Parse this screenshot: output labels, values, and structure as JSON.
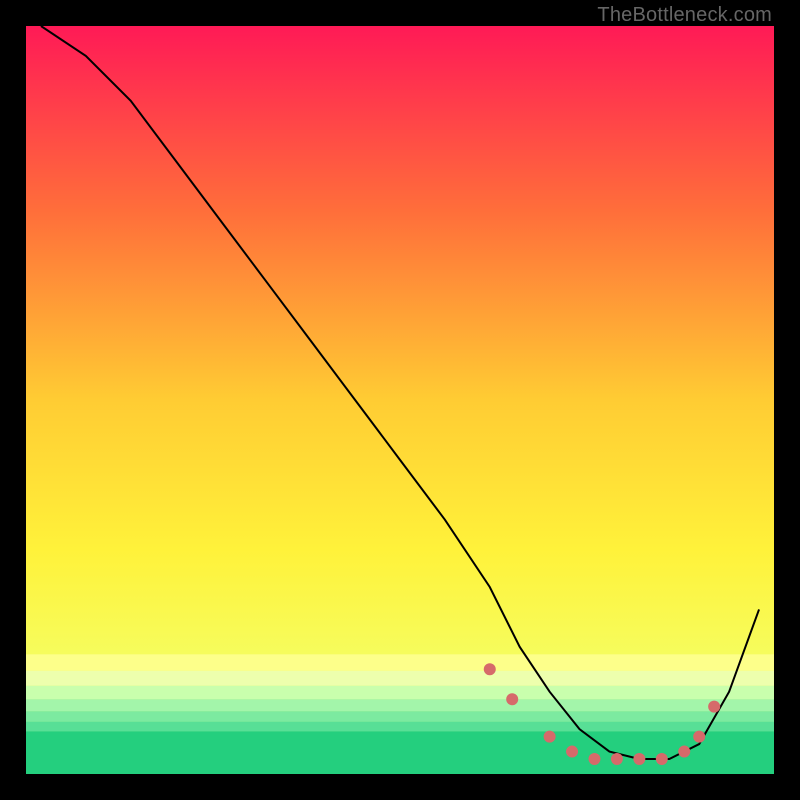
{
  "watermark": "TheBottleneck.com",
  "chart_data": {
    "type": "line",
    "title": "",
    "xlabel": "",
    "ylabel": "",
    "xlim": [
      0,
      100
    ],
    "ylim": [
      0,
      100
    ],
    "grid": false,
    "annotations": [],
    "background": {
      "type": "vertical-gradient",
      "description": "smooth gradient from hot pink at top through orange, yellow, to green at bottom; thin horizontal green/yellow bands near the bottom",
      "stops": [
        {
          "pct": 0,
          "color": "#ff1a56"
        },
        {
          "pct": 25,
          "color": "#ff6f3a"
        },
        {
          "pct": 50,
          "color": "#ffcc33"
        },
        {
          "pct": 70,
          "color": "#fff23a"
        },
        {
          "pct": 88,
          "color": "#f3ff66"
        },
        {
          "pct": 92,
          "color": "#cfff88"
        },
        {
          "pct": 95,
          "color": "#88f0a0"
        },
        {
          "pct": 100,
          "color": "#1fd07a"
        }
      ]
    },
    "series": [
      {
        "name": "bottleneck-curve",
        "color": "#000000",
        "stroke_width": 2,
        "x": [
          2,
          8,
          14,
          20,
          26,
          32,
          38,
          44,
          50,
          56,
          62,
          66,
          70,
          74,
          78,
          82,
          86,
          90,
          94,
          98
        ],
        "y": [
          100,
          96,
          90,
          82,
          74,
          66,
          58,
          50,
          42,
          34,
          25,
          17,
          11,
          6,
          3,
          2,
          2,
          4,
          11,
          22
        ]
      }
    ],
    "dots": {
      "name": "highlight-dots",
      "color": "#d66a6a",
      "radius": 6,
      "x": [
        62,
        65,
        70,
        73,
        76,
        79,
        82,
        85,
        88,
        90,
        92
      ],
      "y": [
        14,
        10,
        5,
        3,
        2,
        2,
        2,
        2,
        3,
        5,
        9
      ]
    }
  }
}
